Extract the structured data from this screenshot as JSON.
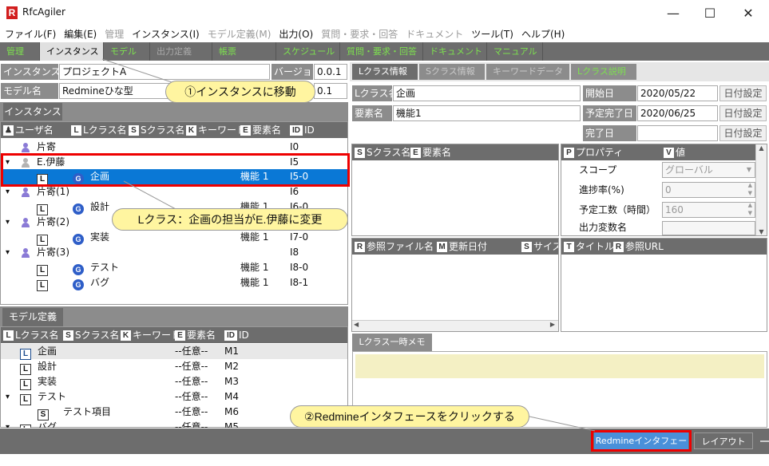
{
  "app": {
    "title": "RfcAgiler",
    "logo": "R"
  },
  "window_controls": {
    "minimize": "—",
    "maximize": "☐",
    "close": "✕"
  },
  "menu": [
    {
      "label": "ファイル(F)",
      "enabled": true
    },
    {
      "label": "編集(E)",
      "enabled": true
    },
    {
      "label": "管理",
      "enabled": false
    },
    {
      "label": "インスタンス(I)",
      "enabled": true
    },
    {
      "label": "モデル定義(M)",
      "enabled": false
    },
    {
      "label": "出力(O)",
      "enabled": true
    },
    {
      "label": "質問・要求・回答",
      "enabled": false
    },
    {
      "label": "ドキュメント",
      "enabled": false
    },
    {
      "label": "ツール(T)",
      "enabled": true
    },
    {
      "label": "ヘルプ(H)",
      "enabled": true
    }
  ],
  "top_tabs": [
    {
      "label": "管理",
      "state": "green"
    },
    {
      "label": "インスタンス",
      "state": "active"
    },
    {
      "label": "モデル",
      "state": "green"
    },
    {
      "label": "出力定義",
      "state": "dim"
    },
    {
      "label": "帳票",
      "state": "green"
    },
    {
      "label": "スケジュール",
      "state": "green"
    },
    {
      "label": "質問・要求・回答",
      "state": "green"
    },
    {
      "label": "ドキュメント",
      "state": "green"
    },
    {
      "label": "マニュアル",
      "state": "green"
    }
  ],
  "instance_form": {
    "name_label": "インスタンス名",
    "name_value": "プロジェクトA",
    "version_label": "バージョン",
    "version_value": "0.0.1",
    "model_label": "モデル名",
    "model_value": "Redmineひな型",
    "model_version_value": "0.1"
  },
  "instance_tab": "インスタンス",
  "instance_tree": {
    "headers": [
      {
        "icon": "user-icon",
        "letter": "👤",
        "label": "ユーザ名"
      },
      {
        "icon": "L-icon",
        "letter": "L",
        "label": "Lクラス名"
      },
      {
        "icon": "S-icon",
        "letter": "S",
        "label": "Sクラス名"
      },
      {
        "icon": "K-icon",
        "letter": "K",
        "label": "キーワード"
      },
      {
        "icon": "E-icon",
        "letter": "E",
        "label": "要素名"
      },
      {
        "icon": "ID-icon",
        "letter": "ID",
        "label": "ID"
      }
    ],
    "rows": [
      {
        "kind": "user",
        "expand": "",
        "name": "片寄",
        "elem": "",
        "id": "I0"
      },
      {
        "kind": "user-gray",
        "expand": "▾",
        "name": "E.伊藤",
        "elem": "",
        "id": "I5"
      },
      {
        "kind": "lclass",
        "name": "企画",
        "elem": "機能 1",
        "id": "I5-0",
        "selected": true
      },
      {
        "kind": "user",
        "expand": "▾",
        "name": "片寄(1)",
        "elem": "",
        "id": "I6"
      },
      {
        "kind": "lclass",
        "name": "設計",
        "elem": "機能 1",
        "id": "I6-0"
      },
      {
        "kind": "user",
        "expand": "▾",
        "name": "片寄(2)",
        "elem": "",
        "id": "I7"
      },
      {
        "kind": "lclass",
        "name": "実装",
        "elem": "機能 1",
        "id": "I7-0"
      },
      {
        "kind": "user",
        "expand": "▾",
        "name": "片寄(3)",
        "elem": "",
        "id": "I8"
      },
      {
        "kind": "lclass",
        "name": "テスト",
        "elem": "機能 1",
        "id": "I8-0"
      },
      {
        "kind": "lclass",
        "name": "バグ",
        "elem": "機能 1",
        "id": "I8-1"
      }
    ]
  },
  "model_tab": "モデル定義",
  "model_tree": {
    "headers": [
      {
        "letter": "L",
        "label": "Lクラス名"
      },
      {
        "letter": "S",
        "label": "Sクラス名"
      },
      {
        "letter": "K",
        "label": "キーワード"
      },
      {
        "letter": "E",
        "label": "要素名"
      },
      {
        "letter": "ID",
        "label": "ID"
      }
    ],
    "rows": [
      {
        "expand": "",
        "box": "L",
        "name": "企画",
        "elem": "--任意--",
        "id": "M1",
        "highlight": true
      },
      {
        "expand": "",
        "box": "L",
        "name": "設計",
        "elem": "--任意--",
        "id": "M2"
      },
      {
        "expand": "",
        "box": "L",
        "name": "実装",
        "elem": "--任意--",
        "id": "M3"
      },
      {
        "expand": "▾",
        "box": "L",
        "name": "テスト",
        "elem": "--任意--",
        "id": "M4"
      },
      {
        "expand": "",
        "box": "S",
        "name": "テスト項目",
        "elem": "--任意--",
        "id": "M6",
        "indent": true
      },
      {
        "expand": "▾",
        "box": "L",
        "name": "バグ",
        "elem": "--任意--",
        "id": "M5"
      }
    ]
  },
  "right_tabs": [
    {
      "label": "Lクラス情報",
      "state": "on"
    },
    {
      "label": "Sクラス情報",
      "state": "dim"
    },
    {
      "label": "キーワードデータ",
      "state": "dim"
    },
    {
      "label": "Lクラス説明",
      "state": "green"
    }
  ],
  "lclass_form": {
    "lclass_label": "Lクラス名",
    "lclass_value": "企画",
    "elem_label": "要素名",
    "elem_value": "機能1",
    "start_label": "開始日",
    "start_value": "2020/05/22",
    "plan_end_label": "予定完了日",
    "plan_end_value": "2020/06/25",
    "end_label": "完了日",
    "end_value": "",
    "date_button": "日付設定"
  },
  "sclass_list": {
    "headers": [
      {
        "letter": "S",
        "label": "Sクラス名"
      },
      {
        "letter": "E",
        "label": "要素名"
      }
    ]
  },
  "property_grid": {
    "headers": [
      {
        "letter": "P",
        "label": "プロパティ"
      },
      {
        "letter": "V",
        "label": "値"
      }
    ],
    "rows": [
      {
        "name": "スコープ",
        "value": "グローバル",
        "control": "dropdown"
      },
      {
        "name": "進捗率(%)",
        "value": "0",
        "control": "spin"
      },
      {
        "name": "予定工数（時間）",
        "value": "160",
        "control": "spin"
      },
      {
        "name": "出力変数名",
        "value": "",
        "control": "dropdown"
      }
    ]
  },
  "ref_files": {
    "headers": [
      {
        "letter": "R",
        "label": "参照ファイル名"
      },
      {
        "letter": "M",
        "label": "更新日付"
      },
      {
        "letter": "S",
        "label": "サイズ"
      }
    ]
  },
  "ref_urls": {
    "headers": [
      {
        "letter": "T",
        "label": "タイトル"
      },
      {
        "letter": "R",
        "label": "参照URL"
      }
    ]
  },
  "memo_tab": "Lクラス一時メモ",
  "bottom_buttons": {
    "redmine": "Redmineインタフェース",
    "layout": "レイアウト"
  },
  "annotations": {
    "step1": "①インスタンスに移動",
    "note": "Lクラス：企画の担当がE.伊藤に変更",
    "step2": "②Redmineインタフェースをクリックする"
  },
  "colors": {
    "accent_green": "#7de04f",
    "selection": "#0a78d6",
    "callout": "#fff5a0",
    "highlight_frame": "#e00000",
    "panel_gray": "#6d6d6d"
  }
}
